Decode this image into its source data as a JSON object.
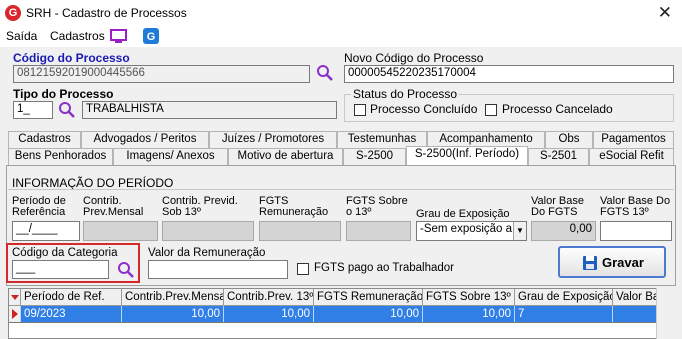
{
  "window": {
    "title": "SRH - Cadastro de Processos",
    "close_glyph": "✕",
    "logo_letter": "G"
  },
  "menu": {
    "items": [
      "Saída",
      "Cadastros"
    ]
  },
  "codigo_processo": {
    "label": "Código do Processo",
    "value": "08121592019000445566"
  },
  "novo_codigo": {
    "label": "Novo Código do Processo",
    "value": "00000545220235170004"
  },
  "tipo_processo": {
    "label": "Tipo do Processo",
    "code": "1_",
    "description": "TRABALHISTA"
  },
  "status": {
    "title": "Status do Processo",
    "concluido": "Processo Concluído",
    "cancelado": "Processo Cancelado"
  },
  "tabs_row1": [
    "Cadastros",
    "Advogados / Peritos",
    "Juízes / Promotores",
    "Testemunhas",
    "Acompanhamento",
    "Obs",
    "Pagamentos"
  ],
  "tabs_row2": [
    "Bens Penhorados",
    "Imagens/ Anexos",
    "Motivo de abertura",
    "S-2500",
    "S-2500(Inf. Período)",
    "S-2501",
    "eSocial Refit"
  ],
  "panel": {
    "title": "INFORMAÇÃO DO PERÍODO",
    "col_periodo": "Período de Referência",
    "col_contrib_mensal": "Contrib. Prev.Mensal",
    "col_contrib_13": "Contrib. Previd. Sob 13º",
    "col_fgts_rem": "FGTS Remuneração",
    "col_fgts_13": "FGTS Sobre o 13º",
    "col_grau": "Grau de Exposição",
    "col_vb_fgts": "Valor Base Do FGTS",
    "col_vb_fgts13": "Valor Base Do FGTS 13º",
    "periodo_value": "__/____",
    "grau_value": "-Sem exposição a",
    "vb_fgts_value": "0,00",
    "categoria_label": "Código da Categoria",
    "categoria_value": "___",
    "remuneracao_label": "Valor da Remuneração",
    "fgts_pago_label": "FGTS pago ao Trabalhador",
    "gravar_label": "Gravar"
  },
  "grid": {
    "headers": [
      "Período de Ref.",
      "Contrib.Prev.Mensal",
      "Contrib.Prev. 13º",
      "FGTS Remuneração",
      "FGTS Sobre 13º",
      "Grau de Exposição",
      "Valor Base"
    ],
    "rows": [
      {
        "periodo": "09/2023",
        "contrib_mensal": "10,00",
        "contrib_13": "10,00",
        "fgts_rem": "10,00",
        "fgts_13": "10,00",
        "grau": "7",
        "valor_base": ""
      }
    ]
  },
  "colors": {
    "accent_label": "#1a1ab4",
    "selection": "#2f7fe6",
    "highlight_box": "#d42a2a",
    "search_icon": "#8b2fc9"
  }
}
